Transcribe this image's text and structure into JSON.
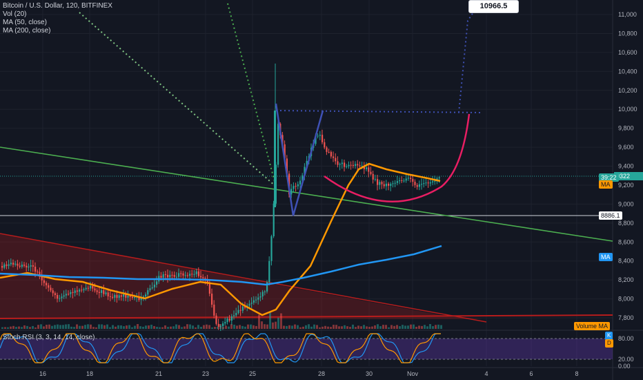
{
  "legend": {
    "symbol": "Bitcoin / U.S. Dollar, 120, BITFINEX",
    "vol": "Vol (20)",
    "ma50": "MA (50, close)",
    "ma200": "MA (200, close)"
  },
  "stoch": {
    "label": "Stoch RSI (3, 3, 14, 14, close)",
    "ylabels": [
      "80.00",
      "20.00",
      "0.00"
    ],
    "buttons": [
      "K",
      "D"
    ]
  },
  "callout": "10966.5",
  "tags": {
    "price": "9322",
    "price_time": "39:22",
    "level": "8886.1",
    "ma": "MA",
    "ma2": "MA",
    "volume_ma": "Volume MA"
  },
  "colors": {
    "background": "#131722",
    "up": "#26a69a",
    "down": "#ef5350",
    "ma50": "#ff9800",
    "ma200": "#2196f3",
    "trendline": "#4caf50",
    "cup": "#e91e63",
    "wedge": "#3f51b5",
    "target": "#3f51b5"
  },
  "chart_data": {
    "type": "candlestick",
    "title": "Bitcoin / U.S. Dollar, 120, BITFINEX",
    "ylim": [
      7650,
      11200
    ],
    "y_ticks": [
      11000,
      10800,
      10600,
      10400,
      10200,
      10000,
      9800,
      9600,
      9400,
      9200,
      9000,
      8800,
      8600,
      8400,
      8200,
      8000,
      7800
    ],
    "x_tick_labels": [
      "16",
      "18",
      "21",
      "23",
      "25",
      "28",
      "30",
      "Nov",
      "4",
      "6",
      "8"
    ],
    "price_series": [
      [
        "14",
        8350
      ],
      [
        "15",
        8300
      ],
      [
        "16",
        8250
      ],
      [
        "17",
        8000
      ],
      [
        "18",
        8150
      ],
      [
        "19",
        8050
      ],
      [
        "20",
        8200
      ],
      [
        "21",
        8280
      ],
      [
        "22",
        8250
      ],
      [
        "23",
        8100
      ],
      [
        "24",
        7550
      ],
      [
        "25a",
        7650
      ],
      [
        "25b",
        8300
      ],
      [
        "25c",
        8900
      ],
      [
        "26a",
        10050
      ],
      [
        "26b",
        9600
      ],
      [
        "26c",
        9150
      ],
      [
        "27a",
        9300
      ],
      [
        "27b",
        9850
      ],
      [
        "28a",
        9450
      ],
      [
        "28b",
        9350
      ],
      [
        "29",
        9400
      ],
      [
        "30",
        9250
      ],
      [
        "31",
        9200
      ],
      [
        "Nov",
        9300
      ],
      [
        "Nov+1",
        9320
      ]
    ],
    "ma50": [
      [
        "14",
        8400
      ],
      [
        "16",
        8280
      ],
      [
        "18",
        8200
      ],
      [
        "21",
        8100
      ],
      [
        "23",
        8150
      ],
      [
        "24",
        8000
      ],
      [
        "25",
        7760
      ],
      [
        "26",
        8000
      ],
      [
        "27",
        8600
      ],
      [
        "28",
        9200
      ],
      [
        "29",
        9420
      ],
      [
        "30",
        9370
      ],
      [
        "31",
        9330
      ],
      [
        "Nov",
        9300
      ]
    ],
    "ma200": [
      [
        "14",
        8250
      ],
      [
        "16",
        8240
      ],
      [
        "18",
        8210
      ],
      [
        "21",
        8200
      ],
      [
        "23",
        8200
      ],
      [
        "25",
        8150
      ],
      [
        "26",
        8240
      ],
      [
        "28",
        8330
      ],
      [
        "30",
        8430
      ],
      [
        "Nov",
        8520
      ],
      [
        "Nov+1",
        8550
      ]
    ],
    "annotations": {
      "target_level": 10966.5,
      "resistance_level": 9950,
      "horizontal_level": 8886.1
    }
  }
}
